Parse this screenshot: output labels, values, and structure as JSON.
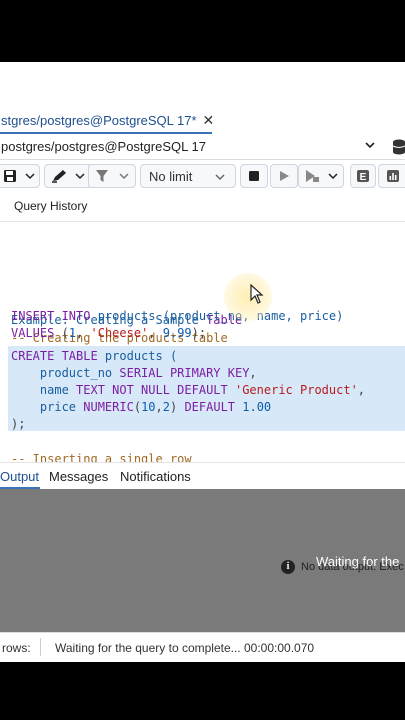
{
  "query_tab": {
    "title": "stgres/postgres@PostgreSQL 17*",
    "close_glyph": "✕"
  },
  "connection": {
    "label": "postgres/postgres@PostgreSQL 17"
  },
  "toolbar": {
    "limit_label": "No limit"
  },
  "subtabs": {
    "query_history": "Query History"
  },
  "editor": {
    "l1_a": "Example: Creating a Sample ",
    "l1_b": "Table",
    "l2": "-- Creating the products table",
    "l3_kw": "CREATE TABLE",
    "l3_id": " products (",
    "l4_id": "    product_no ",
    "l4_kw": "SERIAL PRIMARY KEY",
    "l4_p": ",",
    "l5_id": "    name ",
    "l5_kw": "TEXT NOT NULL DEFAULT",
    "l5_str": " 'Generic Product'",
    "l5_p": ",",
    "l6_id": "    price ",
    "l6_kw": "NUMERIC",
    "l6_p1": "(",
    "l6_n1": "10",
    "l6_p2": ",",
    "l6_n2": "2",
    "l6_p3": ")",
    "l6_kw2": " DEFAULT ",
    "l6_n3": "1.00",
    "l7": ");",
    "l9": "-- Inserting a single row",
    "l10_kw": "INSERT INTO",
    "l10_id": " products (product_no, name, price)",
    "l11_kw": "VALUES",
    "l11_p1": " (",
    "l11_n1": "1",
    "l11_p2": ", ",
    "l11_str": "'Cheese'",
    "l11_p3": ", ",
    "l11_n2": "9.99",
    "l11_p4": ");"
  },
  "output_tabs": {
    "output": "Output",
    "messages": "Messages",
    "notifications": "Notifications"
  },
  "output_panel": {
    "no_data": "No data output. Exec",
    "waiting": "Waiting for the"
  },
  "status": {
    "rows": "rows:",
    "message": "Waiting for the query to complete... 00:00:00.070"
  },
  "colors": {
    "accent": "#3b73b9",
    "selection": "#d7e8f8",
    "keyword": "#7b1fa2",
    "string": "#b71c1c",
    "comment": "#a06a25"
  }
}
